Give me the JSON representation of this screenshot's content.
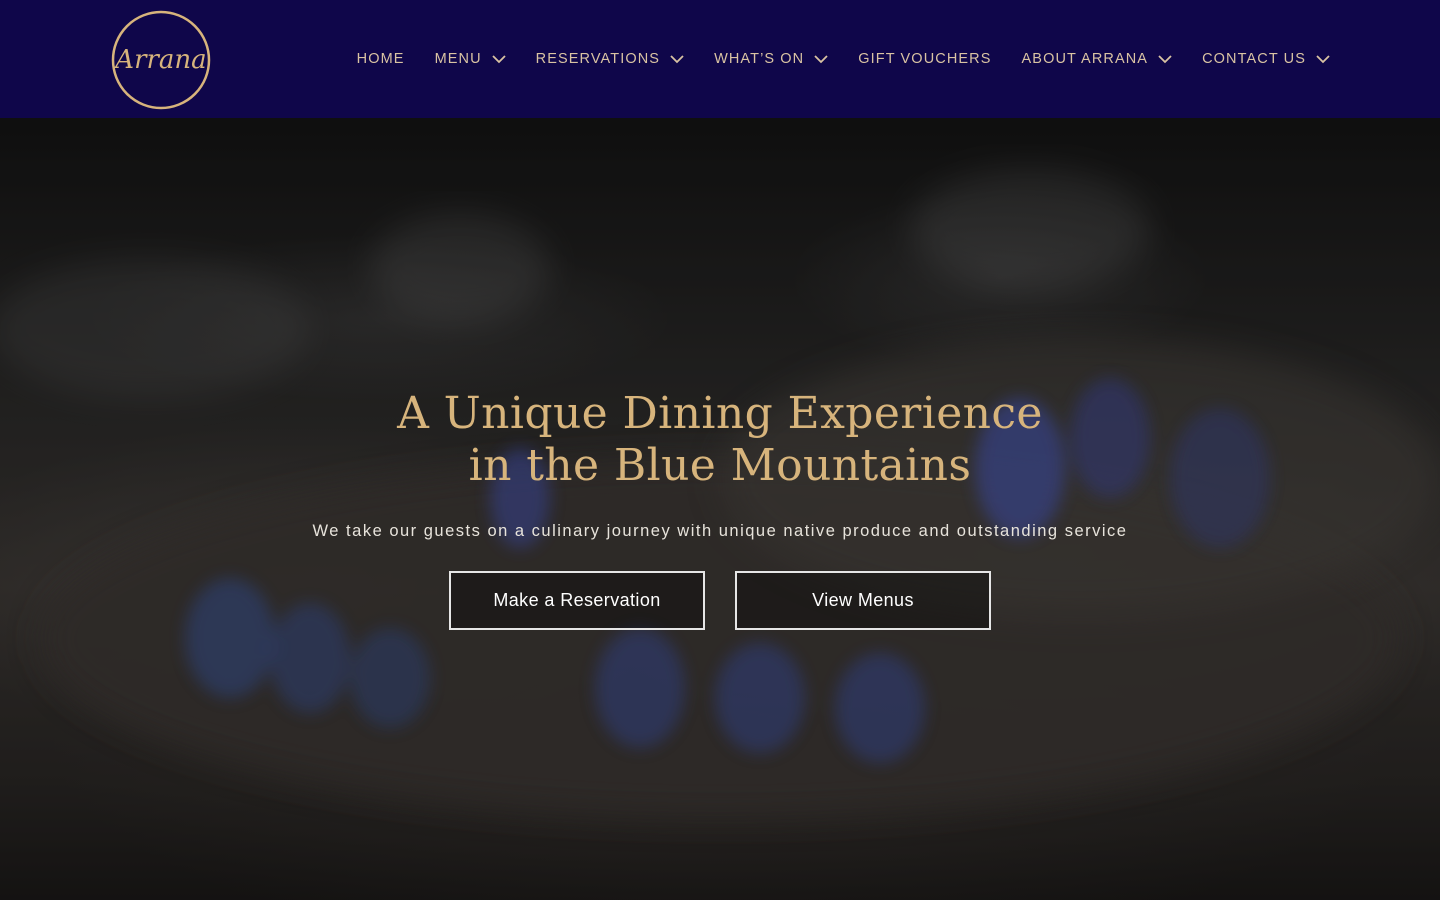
{
  "brand": {
    "logo_text": "Arrana",
    "logo_ring_color": "#d7b47c",
    "header_bg": "#0f064a",
    "accent": "#d7b47c"
  },
  "nav": {
    "items": [
      {
        "label": "HOME",
        "has_dropdown": false
      },
      {
        "label": "MENU",
        "has_dropdown": true
      },
      {
        "label": "RESERVATIONS",
        "has_dropdown": true
      },
      {
        "label": "WHAT’S ON",
        "has_dropdown": true
      },
      {
        "label": "GIFT VOUCHERS",
        "has_dropdown": false
      },
      {
        "label": "ABOUT ARRANA",
        "has_dropdown": true
      },
      {
        "label": "CONTACT US",
        "has_dropdown": true
      }
    ],
    "dropdown_icon": "chevron-down-icon"
  },
  "hero": {
    "title_line1": "A Unique Dining Experience",
    "title_line2": "in the Blue Mountains",
    "subtitle": "We take our guests on a culinary journey with unique native produce and outstanding service",
    "buttons": {
      "reservation": "Make a Reservation",
      "menus": "View Menus"
    },
    "background": "blurred gas stove burners with blue flames"
  }
}
